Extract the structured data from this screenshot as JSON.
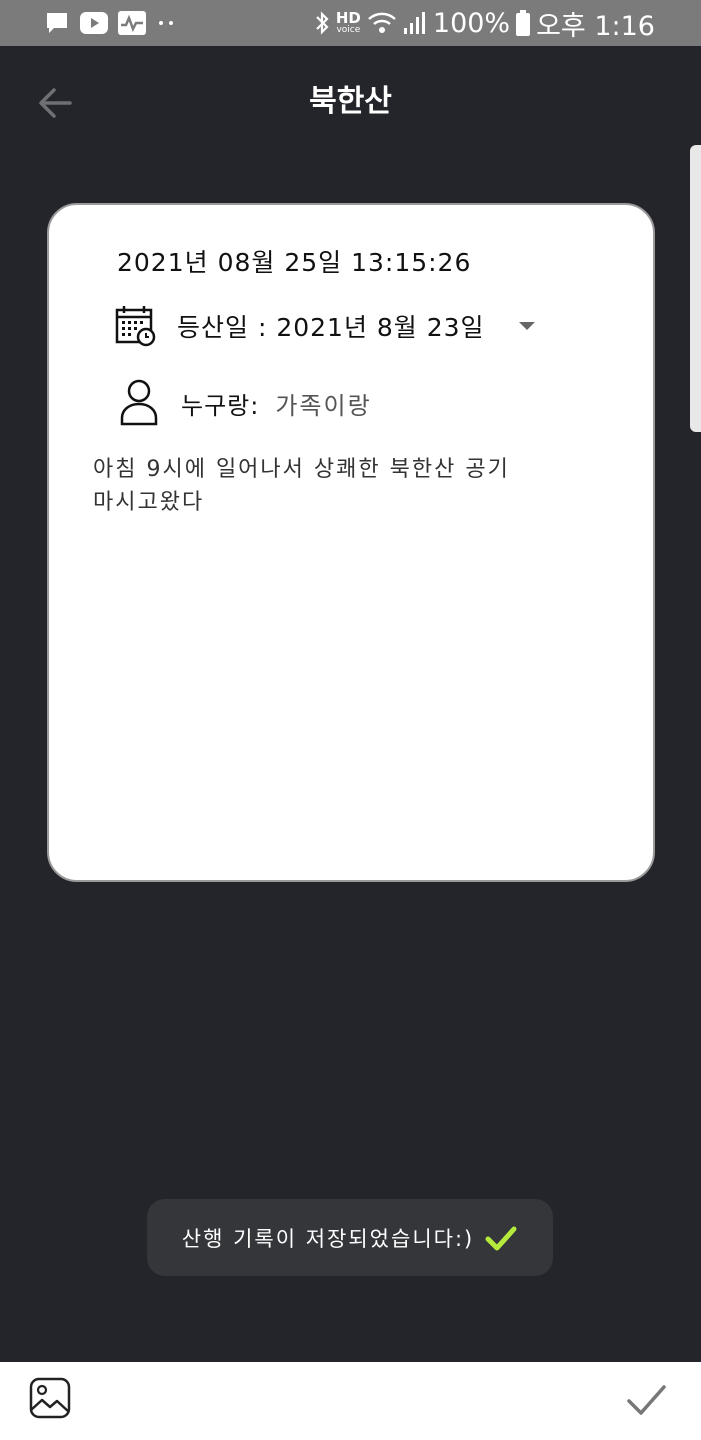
{
  "status_bar": {
    "hd_label": "HD",
    "voice_label": "voice",
    "battery": "100%",
    "time": "오후 1:16"
  },
  "header": {
    "title": "북한산",
    "back_icon": "arrow-left-icon"
  },
  "record": {
    "timestamp": "2021년 08월 25일 13:15:26",
    "climb_date": "등산일 : 2021년 8월 23일",
    "with_label": "누구랑:",
    "with_value": "가족이랑",
    "memo": "아침 9시에 일어나서 상쾌한 북한산 공기 마시고왔다"
  },
  "toast": {
    "message": "산행 기록이 저장되었습니다:)",
    "check_color": "#b5ea3c"
  },
  "bottom_bar": {
    "gallery_icon": "image-icon",
    "confirm_icon": "check-icon"
  },
  "colors": {
    "background": "#24252a",
    "status_bar": "#7b7b7b",
    "card": "#ffffff",
    "toast": "#35363a"
  }
}
